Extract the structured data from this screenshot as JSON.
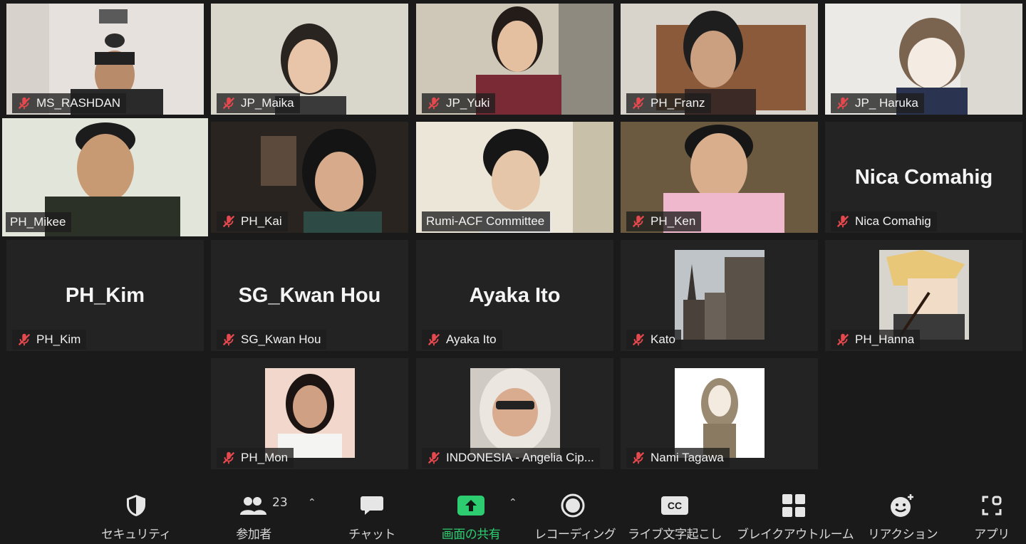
{
  "participants": [
    {
      "name": "MS_RASHDAN",
      "muted": true
    },
    {
      "name": "JP_Maika",
      "muted": true
    },
    {
      "name": "JP_Yuki",
      "muted": true
    },
    {
      "name": "PH_Franz",
      "muted": true
    },
    {
      "name": "JP_ Haruka",
      "muted": true
    },
    {
      "name": "PH_Mikee",
      "muted": false,
      "active_speaker": true
    },
    {
      "name": "PH_Kai",
      "muted": true
    },
    {
      "name": "Rumi-ACF Committee",
      "muted": false
    },
    {
      "name": "PH_Ken",
      "muted": true
    },
    {
      "name": "Nica Comahig",
      "muted": true,
      "display": "Nica Comahig"
    },
    {
      "name": "PH_Kim",
      "muted": true,
      "display": "PH_Kim"
    },
    {
      "name": "SG_Kwan Hou",
      "muted": true,
      "display": "SG_Kwan Hou"
    },
    {
      "name": "Ayaka Ito",
      "muted": true,
      "display": "Ayaka Ito"
    },
    {
      "name": "Kato",
      "muted": true
    },
    {
      "name": "PH_Hanna",
      "muted": true
    },
    {
      "name": "PH_Mon",
      "muted": true
    },
    {
      "name": "INDONESIA - Angelia Cip...",
      "muted": true
    },
    {
      "name": "Nami Tagawa",
      "muted": true
    }
  ],
  "toolbar": {
    "security": "セキュリティ",
    "participants": "参加者",
    "participants_count": "23",
    "chat": "チャット",
    "share_screen": "画面の共有",
    "record": "レコーディング",
    "captions": "ライブ文字起こし",
    "breakout": "ブレイクアウトルーム",
    "reactions": "リアクション",
    "apps": "アプリ",
    "cc_badge": "CC"
  },
  "colors": {
    "active_border": "#e6f07a",
    "share_green": "#2ecc71",
    "muted_red": "#e5484d"
  }
}
